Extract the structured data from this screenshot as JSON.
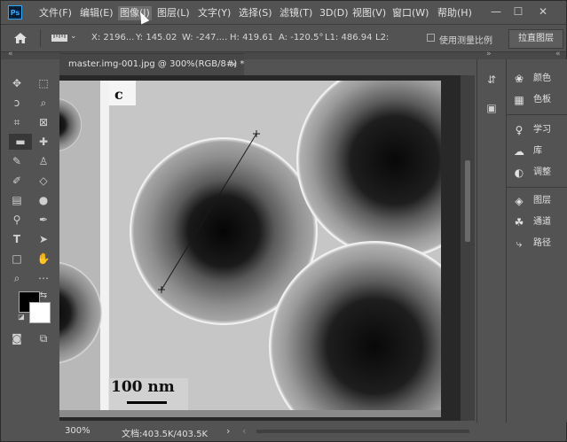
{
  "app": {
    "logo": "Ps"
  },
  "menu": [
    "文件(F)",
    "编辑(E)",
    "图像(I)",
    "图层(L)",
    "文字(Y)",
    "选择(S)",
    "滤镜(T)",
    "3D(D)",
    "视图(V)",
    "窗口(W)",
    "帮助(H)"
  ],
  "window_controls": {
    "minimize": "—",
    "maximize": "☐",
    "close": "✕"
  },
  "options": {
    "x": "X: 2196...",
    "y": "Y: 145.02",
    "w": "W: -247....",
    "h": "H: 419.61",
    "a": "A: -120.5°",
    "l1": "L1: 486.94",
    "l2": "L2:",
    "use_scale": "使用测量比例",
    "straighten": "拉直图层"
  },
  "document": {
    "tab_title": "master.img-001.jpg @ 300%(RGB/8#) *",
    "close": "×"
  },
  "image": {
    "panel_label": "c",
    "scale_bar": "100 nm"
  },
  "status": {
    "zoom": "300%",
    "doc": "文档:403.5K/403.5K"
  },
  "right_panels": {
    "group1": [
      {
        "icon": "palette-icon",
        "label": "颜色"
      },
      {
        "icon": "grid-icon",
        "label": "色板"
      }
    ],
    "group2": [
      {
        "icon": "bulb-icon",
        "label": "学习"
      },
      {
        "icon": "cloud-icon",
        "label": "库"
      },
      {
        "icon": "adjust-icon",
        "label": "调整"
      }
    ],
    "group3": [
      {
        "icon": "layers-icon",
        "label": "图层"
      },
      {
        "icon": "channels-icon",
        "label": "通道"
      },
      {
        "icon": "paths-icon",
        "label": "路径"
      }
    ]
  },
  "colors": {
    "accent": "#31a8ff",
    "ui_bg": "#535353",
    "canvas_bg": "#282828",
    "foreground": "#000000",
    "background": "#ffffff"
  }
}
